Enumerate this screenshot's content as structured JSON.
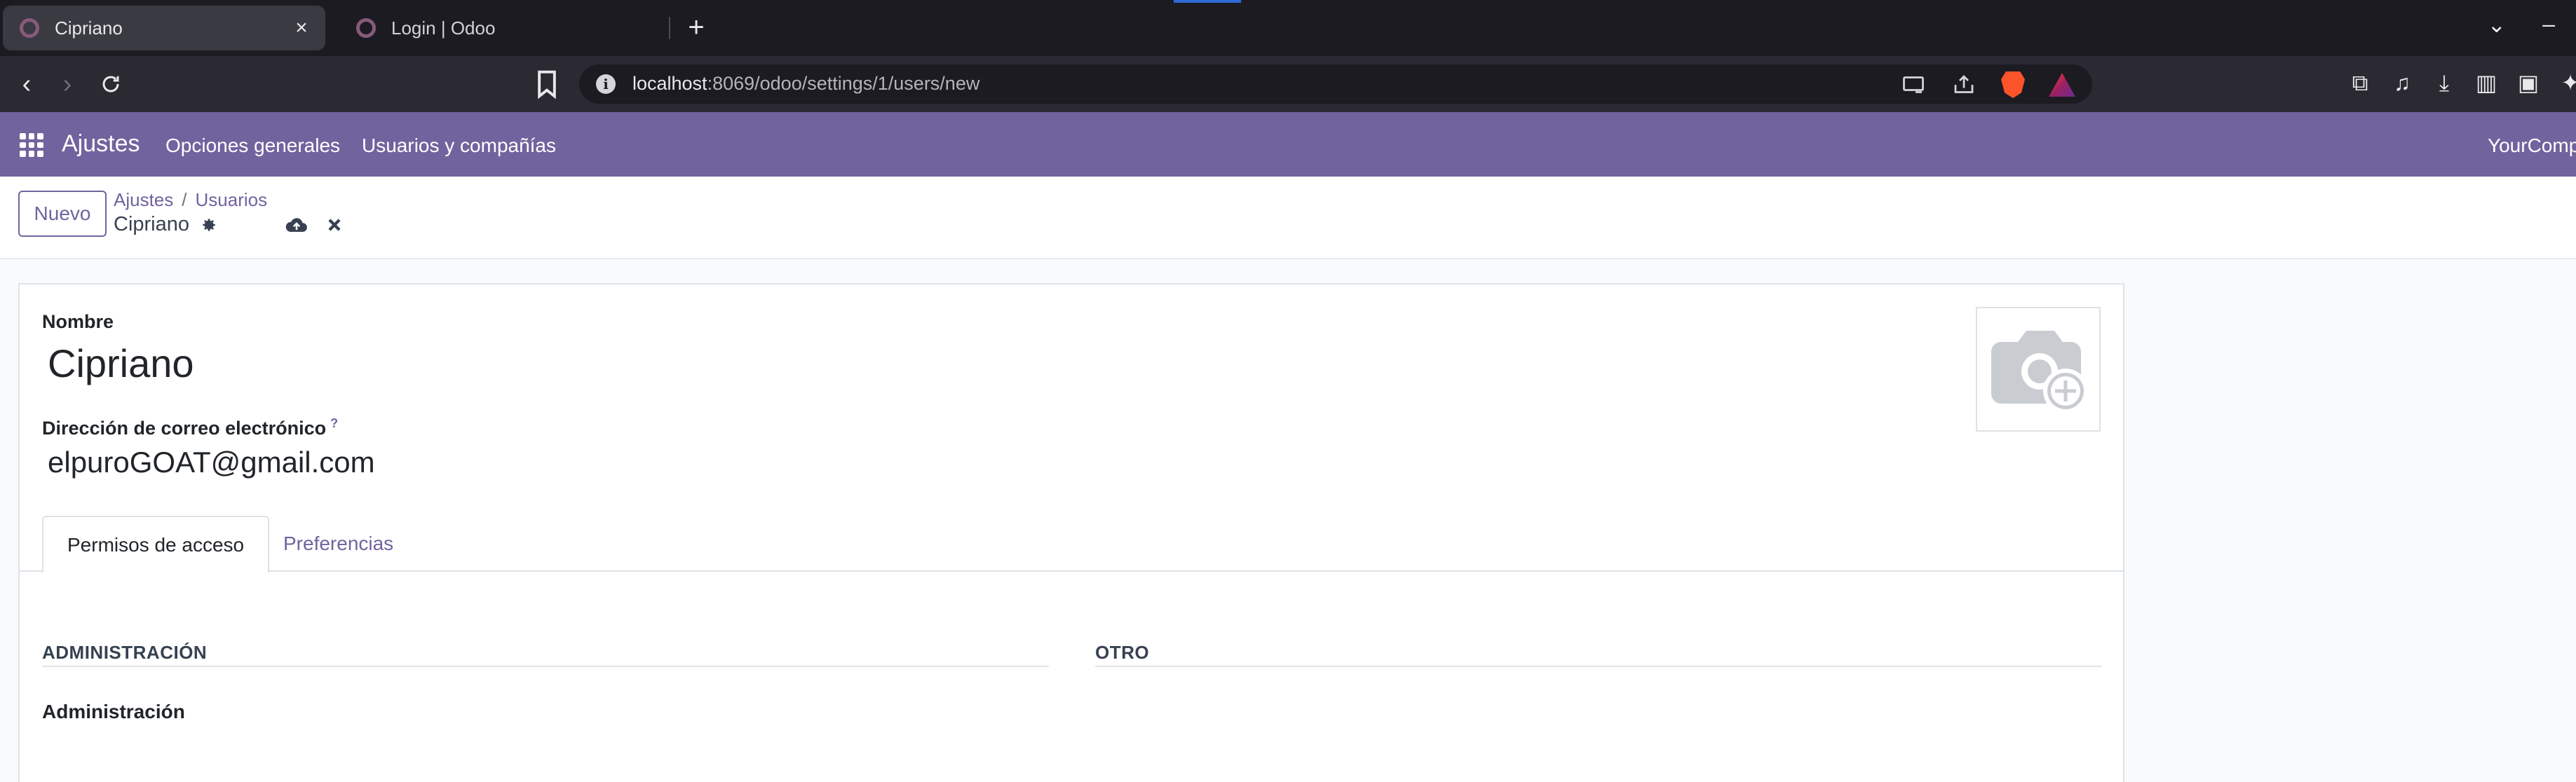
{
  "browser": {
    "tabs": [
      {
        "title": "Cipriano",
        "active": true
      },
      {
        "title": "Login | Odoo",
        "active": false
      }
    ],
    "url_host": "localhost",
    "url_path": ":8069/odoo/settings/1/users/new"
  },
  "navbar": {
    "brand": "Ajustes",
    "menu": [
      "Opciones generales",
      "Usuarios y compañías"
    ],
    "company": "YourCompany",
    "bg_color": "#71639e"
  },
  "control_panel": {
    "new_label": "Nuevo",
    "breadcrumbs": [
      "Ajustes",
      "Usuarios"
    ],
    "record_name": "Cipriano"
  },
  "form": {
    "name_label": "Nombre",
    "name_value": "Cipriano",
    "email_label": "Dirección de correo electrónico",
    "email_help": "?",
    "email_value": "elpuroGOAT@gmail.com",
    "tabs": [
      "Permisos de acceso",
      "Preferencias"
    ],
    "sections": [
      "ADMINISTRACIÓN",
      "OTRO"
    ],
    "sub_label": "Administración"
  },
  "icons": {
    "apps": "apps-grid-icon",
    "gear": "gear-icon",
    "save": "cloud-upload-icon",
    "discard": "close-icon",
    "avatar": "camera-plus-icon"
  }
}
